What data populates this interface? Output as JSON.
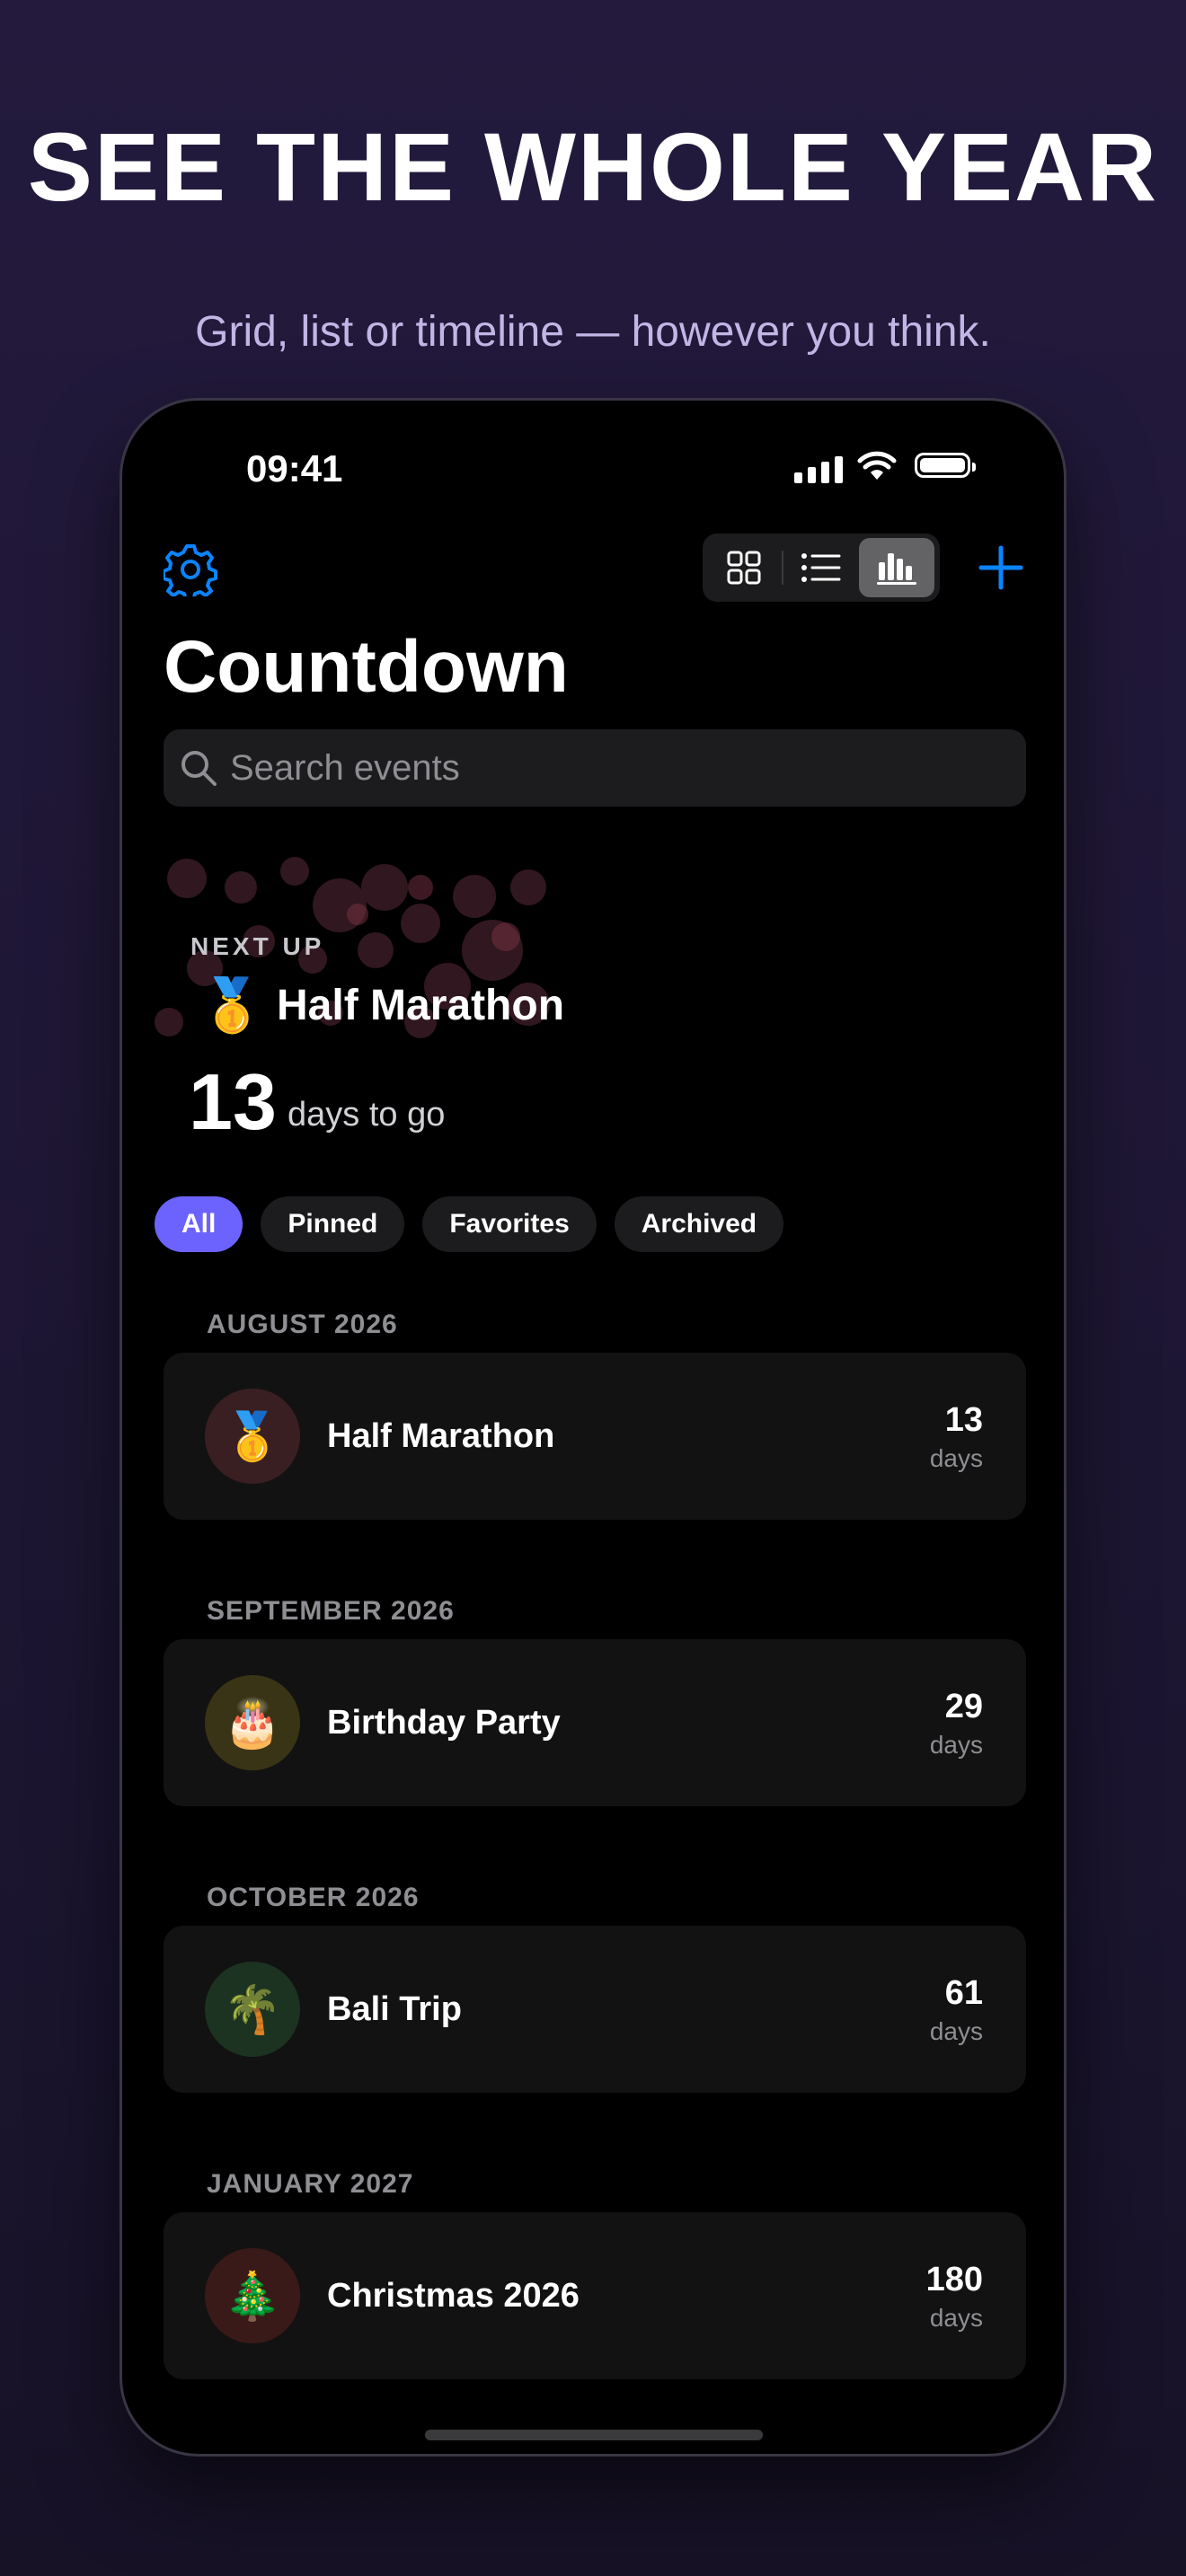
{
  "promo": {
    "headline": "SEE THE WHOLE YEAR",
    "subhead": "Grid, list or timeline — however you think."
  },
  "status_bar": {
    "time": "09:41"
  },
  "toolbar": {
    "settings_icon": "gear-icon",
    "view_modes": [
      "grid",
      "list",
      "timeline"
    ],
    "active_view": "timeline",
    "add_icon": "plus-icon"
  },
  "page": {
    "title": "Countdown"
  },
  "search": {
    "placeholder": "Search events",
    "value": ""
  },
  "next_up": {
    "label": "NEXT UP",
    "emoji": "🥇",
    "title": "Half Marathon",
    "days": "13",
    "suffix": "days to go"
  },
  "filters": [
    {
      "label": "All",
      "active": true
    },
    {
      "label": "Pinned",
      "active": false
    },
    {
      "label": "Favorites",
      "active": false
    },
    {
      "label": "Archived",
      "active": false
    }
  ],
  "groups": [
    {
      "month": "AUGUST 2026",
      "event": {
        "emoji": "🥇",
        "name": "Half Marathon",
        "days": "13",
        "unit": "days",
        "tint": "#3a1f22"
      }
    },
    {
      "month": "SEPTEMBER 2026",
      "event": {
        "emoji": "🎂",
        "name": "Birthday Party",
        "days": "29",
        "unit": "days",
        "tint": "#3a3416"
      }
    },
    {
      "month": "OCTOBER 2026",
      "event": {
        "emoji": "🌴",
        "name": "Bali Trip",
        "days": "61",
        "unit": "days",
        "tint": "#1b3320"
      }
    },
    {
      "month": "JANUARY 2027",
      "event": {
        "emoji": "🎄",
        "name": "Christmas 2026",
        "days": "180",
        "unit": "days",
        "tint": "#3a1a18"
      }
    }
  ],
  "colors": {
    "accent": "#0a84ff",
    "filter_active": "#6c63ff",
    "background": "#000000"
  }
}
